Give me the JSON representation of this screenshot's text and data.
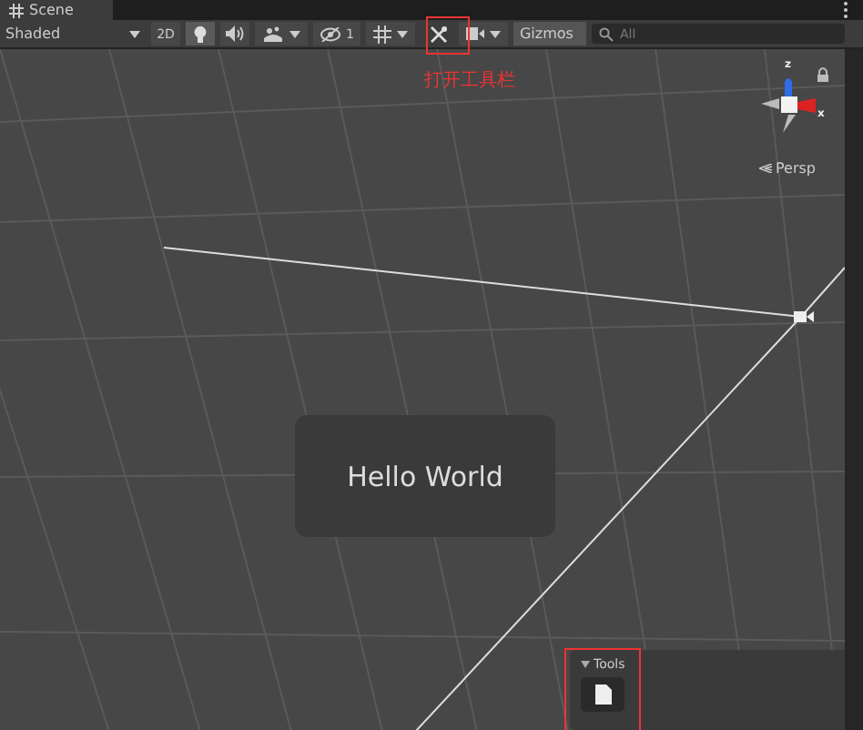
{
  "tab": {
    "title": "Scene"
  },
  "toolbar": {
    "shading_mode": "Shaded",
    "mode_2d": "2D",
    "hidden_count": "1",
    "gizmos": "Gizmos",
    "search": {
      "placeholder": "All"
    }
  },
  "annotation": {
    "text": "打开工具栏"
  },
  "orientation_gizmo": {
    "axes": [
      {
        "label": "z"
      },
      {
        "label": "x"
      }
    ],
    "projection": "Persp"
  },
  "scene": {
    "text": "Hello World"
  },
  "tools_overlay": {
    "title": "Tools"
  }
}
